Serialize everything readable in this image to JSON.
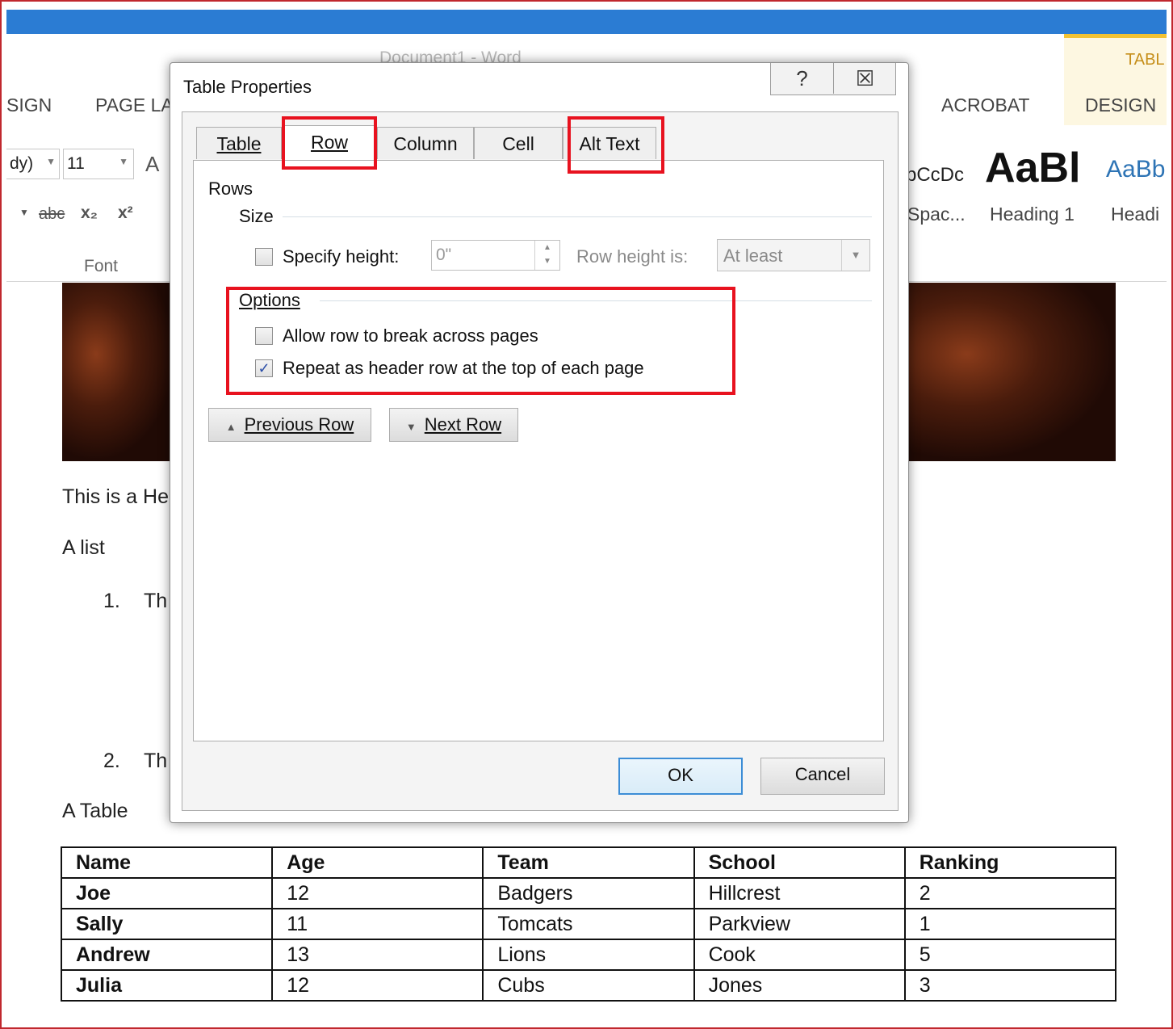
{
  "word": {
    "doc_title": "Document1 - Word",
    "ribbon_tabs": [
      "SIGN",
      "PAGE LA",
      "ACROBAT",
      "DESIGN"
    ],
    "context_tab": "TABL",
    "font_name": "dy)",
    "font_size": "11",
    "font_group": "Font",
    "grow_font": "A",
    "strike": "abc",
    "subscript": "x₂",
    "superscript": "x²",
    "styles": {
      "sample_small": "bCcDc",
      "sample_heading1": "AaBl",
      "sample_heading2": "AaBb",
      "name_spacing": "Spac...",
      "name_heading1": "Heading 1",
      "name_heading2": "Headi"
    }
  },
  "document": {
    "heading_text": "This is a He",
    "list_label": "A list",
    "list_items": [
      {
        "num": "1.",
        "text": "Th"
      },
      {
        "num": "2.",
        "text": "Th"
      }
    ],
    "table_label": "A Table",
    "table": {
      "headers": [
        "Name",
        "Age",
        "Team",
        "School",
        "Ranking"
      ],
      "rows": [
        [
          "Joe",
          "12",
          "Badgers",
          "Hillcrest",
          "2"
        ],
        [
          "Sally",
          "11",
          "Tomcats",
          "Parkview",
          "1"
        ],
        [
          "Andrew",
          "13",
          "Lions",
          "Cook",
          "5"
        ],
        [
          "Julia",
          "12",
          "Cubs",
          "Jones",
          "3"
        ]
      ]
    }
  },
  "dialog": {
    "title": "Table Properties",
    "help_glyph": "?",
    "close_glyph": "☒",
    "tabs": [
      "Table",
      "Row",
      "Column",
      "Cell",
      "Alt Text"
    ],
    "active_tab": "Row",
    "rows_label": "Rows",
    "size_label": "Size",
    "specify_height_label": "Specify height:",
    "specify_height_checked": false,
    "height_value": "0\"",
    "row_height_is_label": "Row height is:",
    "row_height_mode": "At least",
    "options_label": "Options",
    "allow_break_label": "Allow row to break across pages",
    "allow_break_checked": false,
    "repeat_header_label": "Repeat as header row at the top of each page",
    "repeat_header_checked": true,
    "prev_row_label": "Previous Row",
    "next_row_label": "Next Row",
    "ok_label": "OK",
    "cancel_label": "Cancel"
  },
  "annotation_color": "#e8121f"
}
